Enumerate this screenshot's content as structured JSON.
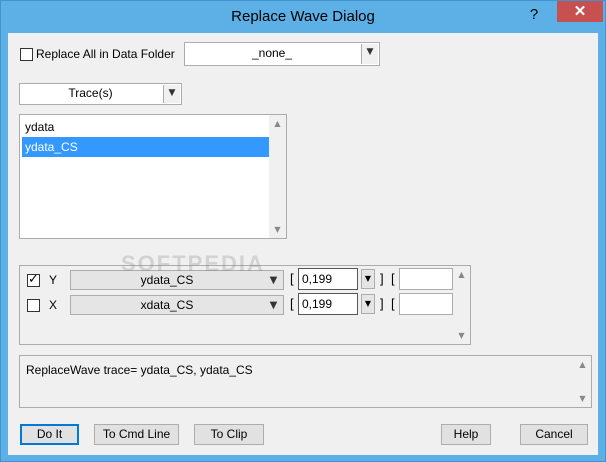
{
  "window": {
    "title": "Replace Wave Dialog",
    "help_glyph": "?",
    "close_glyph": "✕"
  },
  "replace_all": {
    "checked": false,
    "label": "Replace All in Data Folder",
    "folder_value": "_none_"
  },
  "mode_select": {
    "value": "Trace(s)"
  },
  "trace_list": {
    "items": [
      {
        "label": "ydata",
        "selected": false
      },
      {
        "label": "ydata_CS",
        "selected": true
      }
    ]
  },
  "axes": [
    {
      "checked": true,
      "axis": "Y",
      "wave": "ydata_CS",
      "open_bracket": "[",
      "value": "0,199",
      "close_bracket": "]",
      "open_bracket2": "[",
      "extra": ""
    },
    {
      "checked": false,
      "axis": "X",
      "wave": "xdata_CS",
      "open_bracket": "[",
      "value": "0,199",
      "close_bracket": "]",
      "open_bracket2": "[",
      "extra": ""
    }
  ],
  "command": {
    "text": "ReplaceWave trace= ydata_CS, ydata_CS"
  },
  "buttons": {
    "do_it": "Do It",
    "to_cmd_line": "To Cmd Line",
    "to_clip": "To Clip",
    "help": "Help",
    "cancel": "Cancel"
  },
  "watermark": "SOFTPEDIA"
}
